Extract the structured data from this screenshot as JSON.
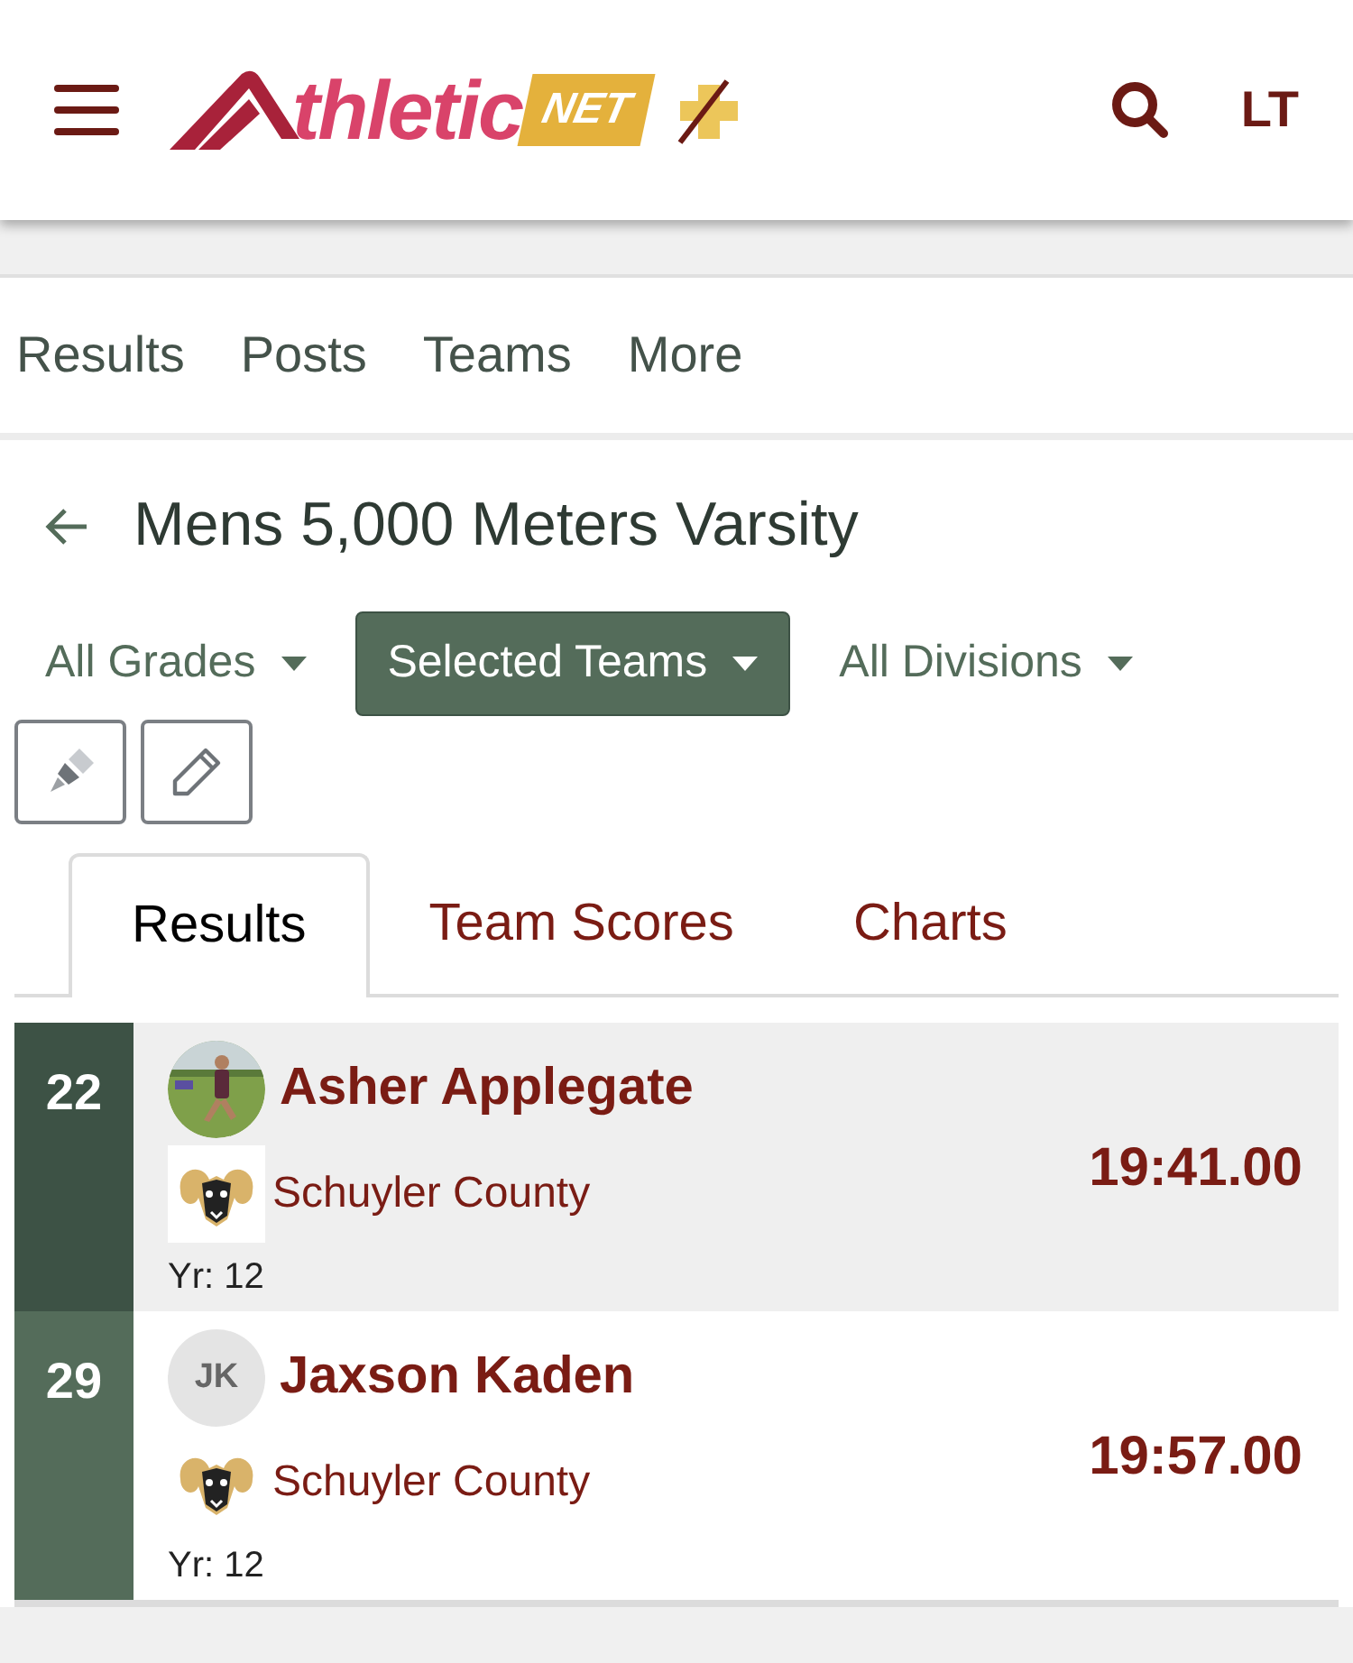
{
  "header": {
    "logo_text": "thletic",
    "logo_badge": "NET",
    "user_initials": "LT"
  },
  "nav": [
    {
      "label": "Results",
      "selected": false
    },
    {
      "label": "Posts",
      "selected": false
    },
    {
      "label": "Teams",
      "selected": false
    },
    {
      "label": "More",
      "selected": false
    }
  ],
  "title": "Mens 5,000 Meters Varsity",
  "filters": [
    {
      "label": "All Grades",
      "selected": false
    },
    {
      "label": "Selected Teams",
      "selected": true
    },
    {
      "label": "All Divisions",
      "selected": false
    }
  ],
  "tabs": [
    {
      "label": "Results",
      "selected": true
    },
    {
      "label": "Team Scores",
      "selected": false
    },
    {
      "label": "Charts",
      "selected": false
    }
  ],
  "results": [
    {
      "place": "22",
      "name": "Asher Applegate",
      "team": "Schuyler County",
      "year": "Yr: 12",
      "time": "19:41.00",
      "selected": true
    },
    {
      "place": "29",
      "name": "Jaxson Kaden",
      "team": "Schuyler County",
      "year": "Yr: 12",
      "time": "19:57.00",
      "selected": false,
      "avatar": {
        "kind": "initials",
        "text": "JK"
      }
    }
  ]
}
